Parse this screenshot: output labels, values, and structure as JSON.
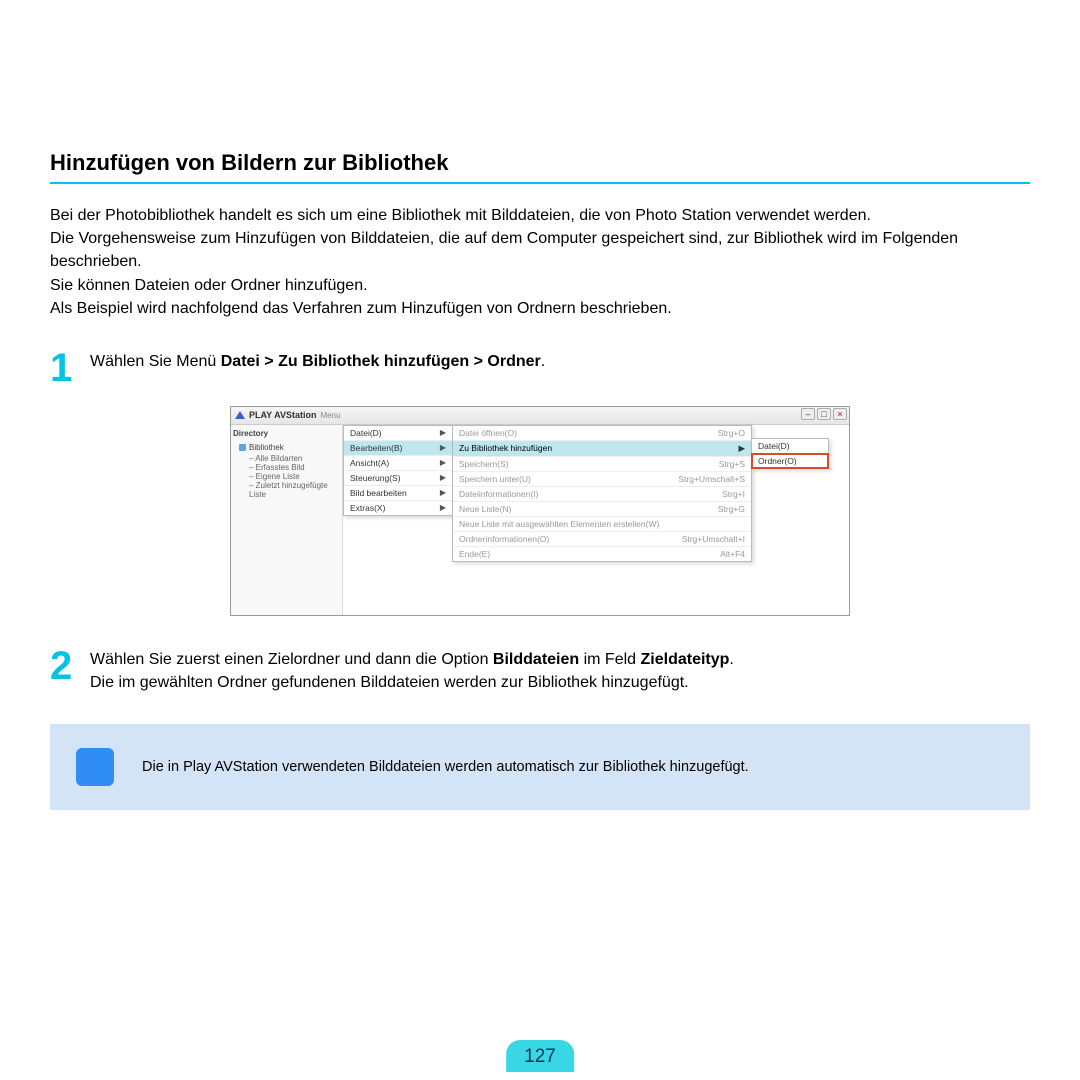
{
  "title": "Hinzufügen von Bildern zur Bibliothek",
  "intro": {
    "p1": "Bei der Photobibliothek handelt es sich um eine Bibliothek mit Bilddateien, die von Photo Station verwendet werden.",
    "p2": "Die Vorgehensweise zum Hinzufügen von Bilddateien, die auf dem Computer gespeichert sind, zur Bibliothek wird im Folgenden beschrieben.",
    "p3": "Sie können Dateien oder Ordner hinzufügen.",
    "p4": "Als Beispiel wird nachfolgend das Verfahren zum Hinzufügen von Ordnern beschrieben."
  },
  "step1": {
    "num": "1",
    "pre": "Wählen Sie Menü ",
    "bold": "Datei > Zu Bibliothek hinzufügen > Ordner",
    "post": "."
  },
  "app": {
    "title": "PLAY AVStation",
    "menulabel": "Menu",
    "win": {
      "min": "–",
      "max": "□",
      "close": "×"
    },
    "sidebar": {
      "dir": "Directory",
      "root": "Bibliothek",
      "items": [
        "– Alle Bildarten",
        "– Erfasstes Bild",
        "– Eigene Liste",
        "– Zuletzt hinzugefügte Liste"
      ]
    },
    "menu1": [
      {
        "label": "Datei(D)",
        "arrow": "▶",
        "hl": false
      },
      {
        "label": "Bearbeiten(B)",
        "arrow": "▶",
        "hl": true
      },
      {
        "label": "Ansicht(A)",
        "arrow": "▶",
        "hl": false
      },
      {
        "label": "Steuerung(S)",
        "arrow": "▶",
        "hl": false
      },
      {
        "label": "Bild bearbeiten",
        "arrow": "▶",
        "hl": false
      },
      {
        "label": "Extras(X)",
        "arrow": "▶",
        "hl": false
      }
    ],
    "menu2": [
      {
        "label": "Datei öffnen(O)",
        "sc": "Strg+O",
        "active": false
      },
      {
        "label": "Zu Bibliothek hinzufügen",
        "sc": "▶",
        "active": true
      },
      {
        "label": "Speichern(S)",
        "sc": "Strg+S",
        "active": false
      },
      {
        "label": "Speichern unter(U)",
        "sc": "Strg+Umschalt+S",
        "active": false
      },
      {
        "label": "Dateiinformationen(I)",
        "sc": "Strg+I",
        "active": false
      },
      {
        "label": "Neue Liste(N)",
        "sc": "Strg+G",
        "active": false
      },
      {
        "label": "Neue Liste mit ausgewählten Elementen erstellen(W)",
        "sc": "",
        "active": false
      },
      {
        "label": "Ordnerinformationen(O)",
        "sc": "Strg+Umschalt+I",
        "active": false
      },
      {
        "label": "Ende(E)",
        "sc": "Alt+F4",
        "active": false
      }
    ],
    "menu3": [
      {
        "label": "Datei(D)",
        "sel": false
      },
      {
        "label": "Ordner(O)",
        "sel": true
      }
    ]
  },
  "step2": {
    "num": "2",
    "t1a": "Wählen Sie zuerst einen Zielordner und dann die Option ",
    "t1b": "Bilddateien",
    "t1c": " im Feld ",
    "t1d": "Zieldateityp",
    "t1e": ".",
    "t2": "Die im gewählten Ordner gefundenen Bilddateien werden zur Bibliothek hinzugefügt."
  },
  "note": "Die in Play AVStation verwendeten Bilddateien werden automatisch zur Bibliothek hinzugefügt.",
  "page": "127"
}
